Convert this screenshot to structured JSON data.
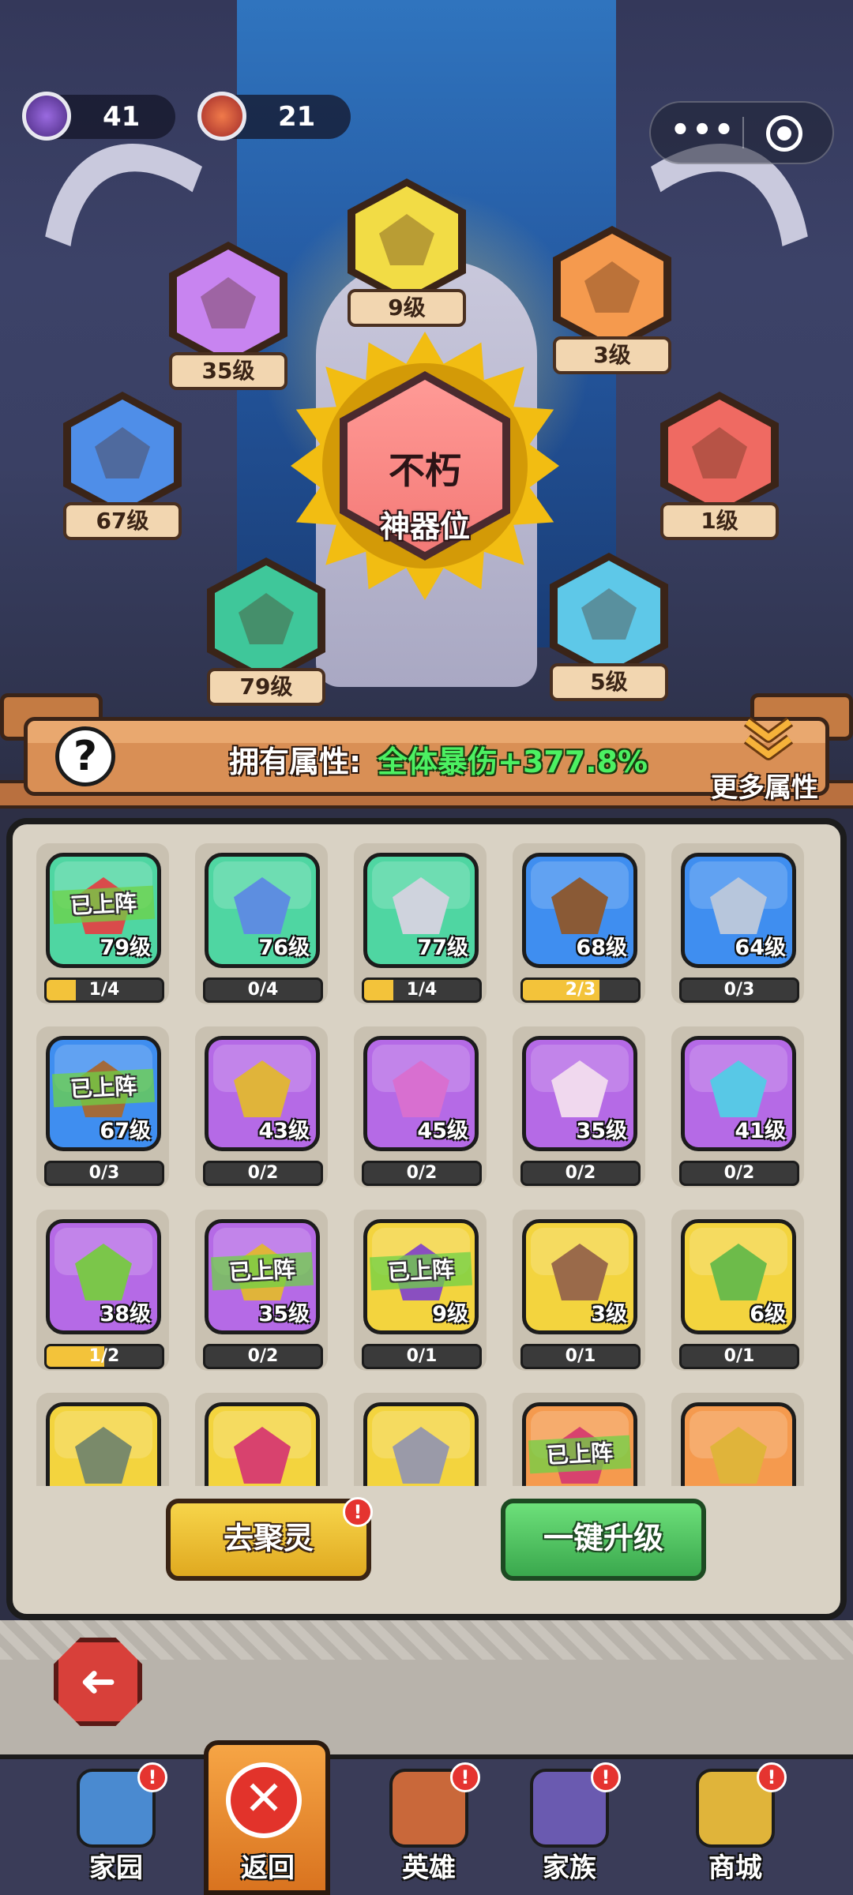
{
  "resources": {
    "soul_orb": {
      "value": "41",
      "icon": "purple-orb-icon"
    },
    "fire_orb": {
      "value": "21",
      "icon": "red-orb-icon"
    }
  },
  "capsule": {
    "more": "•••",
    "close_icon": "target-icon"
  },
  "slots": [
    {
      "level": "9级",
      "color": "#f2dc45",
      "icon": "purple-crown-gem-icon"
    },
    {
      "level": "35级",
      "color": "#c884f0",
      "icon": "gold-crown-icon"
    },
    {
      "level": "3级",
      "color": "#f59a4e",
      "icon": "blue-orb-icon"
    },
    {
      "level": "67级",
      "color": "#4f8ee8",
      "icon": "hammer-pouch-icon"
    },
    {
      "level": "1级",
      "color": "#ef6a62",
      "icon": "green-dragon-icon"
    },
    {
      "level": "79级",
      "color": "#3fc79a",
      "icon": "red-crystal-icon"
    },
    {
      "level": "5级",
      "color": "#5ec8e8",
      "icon": "green-beast-icon"
    }
  ],
  "core": {
    "title": "不朽",
    "subtitle": "神器位"
  },
  "attribute": {
    "label": "拥有属性:",
    "value": "全体暴伤+377.8%",
    "more": "更多属性"
  },
  "help_symbol": "?",
  "artifacts": [
    {
      "level": "79级",
      "deployed": "已上阵",
      "progress": "1/4",
      "fill": 0.25,
      "color": "#4fd6a2",
      "art": "#d94b4b"
    },
    {
      "level": "76级",
      "deployed": "",
      "progress": "0/4",
      "fill": 0,
      "color": "#4fd6a2",
      "art": "#5d8ee0"
    },
    {
      "level": "77级",
      "deployed": "",
      "progress": "1/4",
      "fill": 0.25,
      "color": "#4fd6a2",
      "art": "#cfd3dd"
    },
    {
      "level": "68级",
      "deployed": "",
      "progress": "2/3",
      "fill": 0.667,
      "color": "#3f8ef0",
      "art": "#8a5a36"
    },
    {
      "level": "64级",
      "deployed": "",
      "progress": "0/3",
      "fill": 0,
      "color": "#3f8ef0",
      "art": "#b7c6dc"
    },
    {
      "level": "67级",
      "deployed": "已上阵",
      "progress": "0/3",
      "fill": 0,
      "color": "#3f8ef0",
      "art": "#a36a3a"
    },
    {
      "level": "43级",
      "deployed": "",
      "progress": "0/2",
      "fill": 0,
      "color": "#b56ae6",
      "art": "#e0b43a"
    },
    {
      "level": "45级",
      "deployed": "",
      "progress": "0/2",
      "fill": 0,
      "color": "#b56ae6",
      "art": "#d86fd0"
    },
    {
      "level": "35级",
      "deployed": "",
      "progress": "0/2",
      "fill": 0,
      "color": "#b56ae6",
      "art": "#f0d8ee"
    },
    {
      "level": "41级",
      "deployed": "",
      "progress": "0/2",
      "fill": 0,
      "color": "#b56ae6",
      "art": "#58c8e6"
    },
    {
      "level": "38级",
      "deployed": "",
      "progress": "1/2",
      "fill": 0.5,
      "color": "#b56ae6",
      "art": "#7bc64a"
    },
    {
      "level": "35级",
      "deployed": "已上阵",
      "progress": "0/2",
      "fill": 0,
      "color": "#b56ae6",
      "art": "#e0b43a"
    },
    {
      "level": "9级",
      "deployed": "已上阵",
      "progress": "0/1",
      "fill": 0,
      "color": "#f3d43e",
      "art": "#8a4fc0"
    },
    {
      "level": "3级",
      "deployed": "",
      "progress": "0/1",
      "fill": 0,
      "color": "#f3d43e",
      "art": "#9a6a4a"
    },
    {
      "level": "6级",
      "deployed": "",
      "progress": "0/1",
      "fill": 0,
      "color": "#f3d43e",
      "art": "#6dbb4a"
    },
    {
      "level": "",
      "deployed": "",
      "progress": "",
      "fill": 0,
      "color": "#f3d43e",
      "art": "#7a8a6a"
    },
    {
      "level": "",
      "deployed": "",
      "progress": "",
      "fill": 0,
      "color": "#f3d43e",
      "art": "#d8426e"
    },
    {
      "level": "",
      "deployed": "",
      "progress": "",
      "fill": 0,
      "color": "#f3d43e",
      "art": "#9a9aa8"
    },
    {
      "level": "",
      "deployed": "已上阵",
      "progress": "",
      "fill": 0,
      "color": "#f59a4e",
      "art": "#d8426e"
    },
    {
      "level": "",
      "deployed": "",
      "progress": "",
      "fill": 0,
      "color": "#f59a4e",
      "art": "#e0b43a"
    }
  ],
  "buttons": {
    "gather": "去聚灵",
    "upgrade_all": "一键升级",
    "badge": "!"
  },
  "back": {
    "symbol": "➜"
  },
  "nav": [
    {
      "label": "家园",
      "icon": "home-castle-icon",
      "badge": "!"
    },
    {
      "label": "返回",
      "icon": "close-icon",
      "badge": ""
    },
    {
      "label": "英雄",
      "icon": "hero-portrait-icon",
      "badge": "!"
    },
    {
      "label": "家族",
      "icon": "family-crest-icon",
      "badge": "!"
    },
    {
      "label": "商城",
      "icon": "shop-cannon-icon",
      "badge": "!"
    }
  ]
}
